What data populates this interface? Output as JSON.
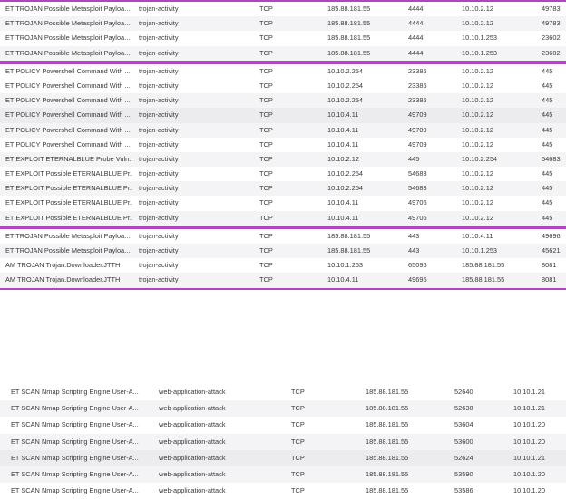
{
  "accent_color": "#b144c0",
  "alerts_top": [
    {
      "signature": "ET TROJAN Possible Metasploit Payloa...",
      "classification": "trojan-activity",
      "protocol": "TCP",
      "src_ip": "185.88.181.55",
      "src_port": "4444",
      "dst_ip": "10.10.2.12",
      "dst_port": "49783"
    },
    {
      "signature": "ET TROJAN Possible Metasploit Payloa...",
      "classification": "trojan-activity",
      "protocol": "TCP",
      "src_ip": "185.88.181.55",
      "src_port": "4444",
      "dst_ip": "10.10.2.12",
      "dst_port": "49783"
    },
    {
      "signature": "ET TROJAN Possible Metasploit Payloa...",
      "classification": "trojan-activity",
      "protocol": "TCP",
      "src_ip": "185.88.181.55",
      "src_port": "4444",
      "dst_ip": "10.10.1.253",
      "dst_port": "23602"
    },
    {
      "signature": "ET TROJAN Possible Metasploit Payloa...",
      "classification": "trojan-activity",
      "protocol": "TCP",
      "src_ip": "185.88.181.55",
      "src_port": "4444",
      "dst_ip": "10.10.1.253",
      "dst_port": "23602"
    },
    {
      "signature": "ET POLICY Powershell Command With ...",
      "classification": "trojan-activity",
      "protocol": "TCP",
      "src_ip": "10.10.2.254",
      "src_port": "23385",
      "dst_ip": "10.10.2.12",
      "dst_port": "445"
    },
    {
      "signature": "ET POLICY Powershell Command With ...",
      "classification": "trojan-activity",
      "protocol": "TCP",
      "src_ip": "10.10.2.254",
      "src_port": "23385",
      "dst_ip": "10.10.2.12",
      "dst_port": "445"
    },
    {
      "signature": "ET POLICY Powershell Command With ...",
      "classification": "trojan-activity",
      "protocol": "TCP",
      "src_ip": "10.10.2.254",
      "src_port": "23385",
      "dst_ip": "10.10.2.12",
      "dst_port": "445"
    },
    {
      "signature": "ET POLICY Powershell Command With ...",
      "classification": "trojan-activity",
      "protocol": "TCP",
      "src_ip": "10.10.4.11",
      "src_port": "49709",
      "dst_ip": "10.10.2.12",
      "dst_port": "445"
    },
    {
      "signature": "ET POLICY Powershell Command With ...",
      "classification": "trojan-activity",
      "protocol": "TCP",
      "src_ip": "10.10.4.11",
      "src_port": "49709",
      "dst_ip": "10.10.2.12",
      "dst_port": "445"
    },
    {
      "signature": "ET POLICY Powershell Command With ...",
      "classification": "trojan-activity",
      "protocol": "TCP",
      "src_ip": "10.10.4.11",
      "src_port": "49709",
      "dst_ip": "10.10.2.12",
      "dst_port": "445"
    },
    {
      "signature": "ET EXPLOIT ETERNALBLUE Probe Vuln...",
      "classification": "trojan-activity",
      "protocol": "TCP",
      "src_ip": "10.10.2.12",
      "src_port": "445",
      "dst_ip": "10.10.2.254",
      "dst_port": "54683"
    },
    {
      "signature": "ET EXPLOIT Possible ETERNALBLUE Pr...",
      "classification": "trojan-activity",
      "protocol": "TCP",
      "src_ip": "10.10.2.254",
      "src_port": "54683",
      "dst_ip": "10.10.2.12",
      "dst_port": "445"
    },
    {
      "signature": "ET EXPLOIT Possible ETERNALBLUE Pr...",
      "classification": "trojan-activity",
      "protocol": "TCP",
      "src_ip": "10.10.2.254",
      "src_port": "54683",
      "dst_ip": "10.10.2.12",
      "dst_port": "445"
    },
    {
      "signature": "ET EXPLOIT Possible ETERNALBLUE Pr...",
      "classification": "trojan-activity",
      "protocol": "TCP",
      "src_ip": "10.10.4.11",
      "src_port": "49706",
      "dst_ip": "10.10.2.12",
      "dst_port": "445"
    },
    {
      "signature": "ET EXPLOIT Possible ETERNALBLUE Pr...",
      "classification": "trojan-activity",
      "protocol": "TCP",
      "src_ip": "10.10.4.11",
      "src_port": "49706",
      "dst_ip": "10.10.2.12",
      "dst_port": "445"
    },
    {
      "signature": "ET TROJAN Possible Metasploit Payloa...",
      "classification": "trojan-activity",
      "protocol": "TCP",
      "src_ip": "185.88.181.55",
      "src_port": "443",
      "dst_ip": "10.10.4.11",
      "dst_port": "49696"
    },
    {
      "signature": "ET TROJAN Possible Metasploit Payloa...",
      "classification": "trojan-activity",
      "protocol": "TCP",
      "src_ip": "185.88.181.55",
      "src_port": "443",
      "dst_ip": "10.10.1.253",
      "dst_port": "45621"
    },
    {
      "signature": "AM TROJAN Trojan.Downloader.JTTH",
      "classification": "trojan-activity",
      "protocol": "TCP",
      "src_ip": "10.10.1.253",
      "src_port": "65095",
      "dst_ip": "185.88.181.55",
      "dst_port": "8081"
    },
    {
      "signature": "AM TROJAN Trojan.Downloader.JTTH",
      "classification": "trojan-activity",
      "protocol": "TCP",
      "src_ip": "10.10.4.11",
      "src_port": "49695",
      "dst_ip": "185.88.181.55",
      "dst_port": "8081"
    }
  ],
  "alerts_bottom": [
    {
      "signature": "ET SCAN Nmap Scripting Engine User-A...",
      "classification": "web-application-attack",
      "protocol": "TCP",
      "src_ip": "185.88.181.55",
      "src_port": "52640",
      "dst_ip": "10.10.1.21"
    },
    {
      "signature": "ET SCAN Nmap Scripting Engine User-A...",
      "classification": "web-application-attack",
      "protocol": "TCP",
      "src_ip": "185.88.181.55",
      "src_port": "52638",
      "dst_ip": "10.10.1.21"
    },
    {
      "signature": "ET SCAN Nmap Scripting Engine User-A...",
      "classification": "web-application-attack",
      "protocol": "TCP",
      "src_ip": "185.88.181.55",
      "src_port": "53604",
      "dst_ip": "10.10.1.20"
    },
    {
      "signature": "ET SCAN Nmap Scripting Engine User-A...",
      "classification": "web-application-attack",
      "protocol": "TCP",
      "src_ip": "185.88.181.55",
      "src_port": "53600",
      "dst_ip": "10.10.1.20"
    },
    {
      "signature": "ET SCAN Nmap Scripting Engine User-A...",
      "classification": "web-application-attack",
      "protocol": "TCP",
      "src_ip": "185.88.181.55",
      "src_port": "52624",
      "dst_ip": "10.10.1.21"
    },
    {
      "signature": "ET SCAN Nmap Scripting Engine User-A...",
      "classification": "web-application-attack",
      "protocol": "TCP",
      "src_ip": "185.88.181.55",
      "src_port": "53590",
      "dst_ip": "10.10.1.20"
    },
    {
      "signature": "ET SCAN Nmap Scripting Engine User-A...",
      "classification": "web-application-attack",
      "protocol": "TCP",
      "src_ip": "185.88.181.55",
      "src_port": "53586",
      "dst_ip": "10.10.1.20"
    }
  ]
}
